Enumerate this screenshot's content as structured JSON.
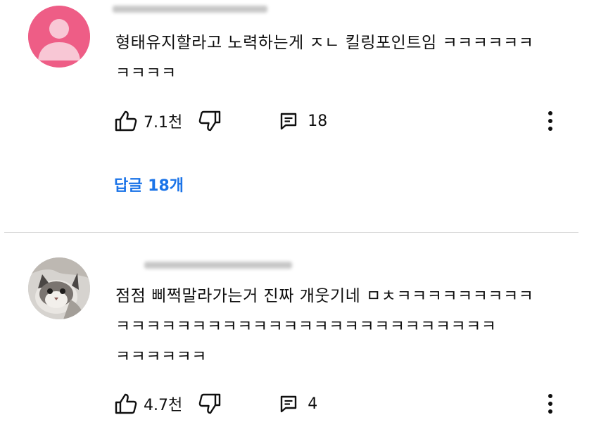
{
  "comments": [
    {
      "text": "형태유지할라고 노력하는게 ㅈㄴ 킬링포인트임 ㅋㅋㅋㅋㅋㅋ\nㅋㅋㅋㅋ",
      "likes": "7.1천",
      "replies": "18",
      "replies_link": "답글 18개",
      "avatar": "default-person-avatar"
    },
    {
      "text": "점점 삐쩍말라가는거 진짜 개웃기네 ㅁㅊㅋㅋㅋㅋㅋㅋㅋㅋㅋ\nㅋㅋㅋㅋㅋㅋㅋㅋㅋㅋㅋㅋㅋㅋㅋㅋㅋㅋㅋㅋㅋㅋㅋㅋㅋ\nㅋㅋㅋㅋㅋㅋ",
      "likes": "4.7천",
      "replies": "4",
      "avatar": "cat-photo-avatar"
    }
  ],
  "colors": {
    "link": "#1a73e8",
    "avatar_pink": "#ee5d86",
    "text": "#0f0f0f",
    "divider": "#dcdcdc"
  },
  "icons": [
    "thumbs-up-icon",
    "thumbs-down-icon",
    "reply-comment-icon",
    "more-vertical-icon"
  ]
}
